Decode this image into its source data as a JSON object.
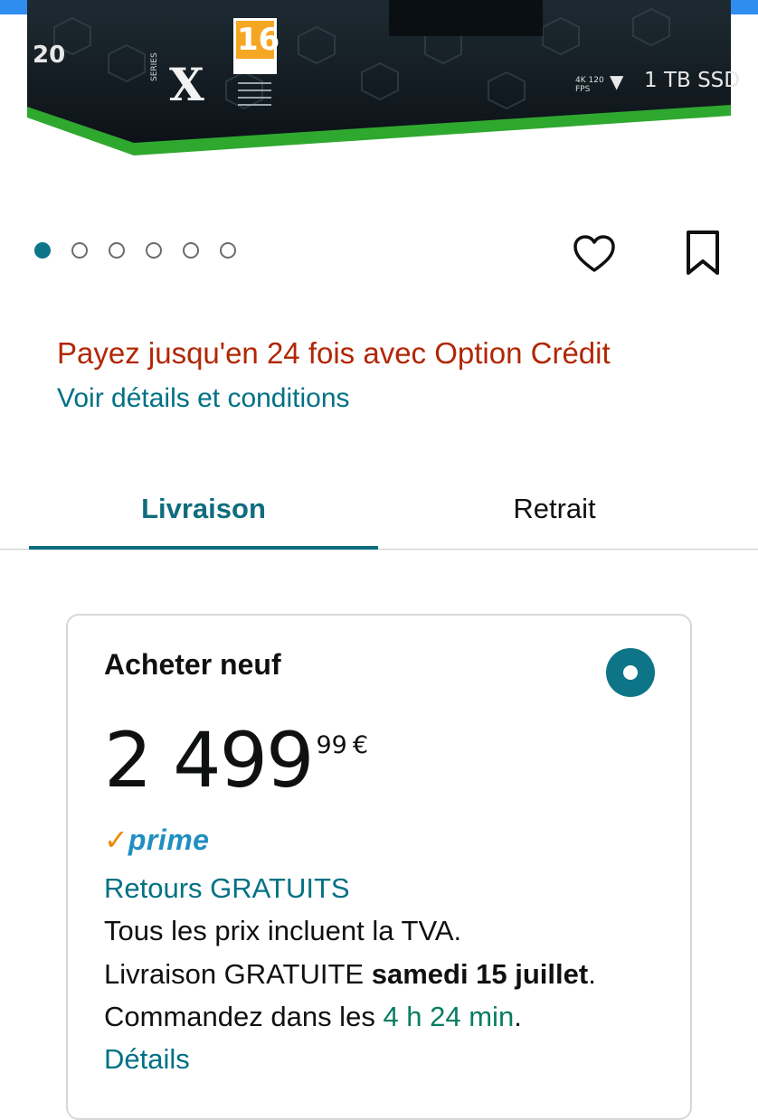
{
  "product_image": {
    "age_rating": "16",
    "series_badge": "X",
    "series_label": "SERIES",
    "spec_badge": "4K 120 FPS",
    "storage_badge": "1 TB SSD",
    "side_number": "20"
  },
  "carousel": {
    "count": 6,
    "active_index": 0
  },
  "actions": {
    "wishlist_icon": "heart-icon",
    "save_icon": "bookmark-icon"
  },
  "promo": {
    "text": "Payez jusqu'en 24 fois avec Option Crédit",
    "link": "Voir détails et conditions"
  },
  "tabs": {
    "delivery": "Livraison",
    "pickup": "Retrait",
    "selected": "Livraison"
  },
  "offer": {
    "title": "Acheter neuf",
    "selected": true,
    "price": {
      "whole": "2 499",
      "fraction": "99",
      "currency": "€"
    },
    "prime_label": "prime",
    "returns": "Retours GRATUITS",
    "vat_note": "Tous les prix incluent la TVA.",
    "delivery_prefix": "Livraison GRATUITE ",
    "delivery_date": "samedi 15 juillet",
    "delivery_suffix": ".",
    "order_prefix": "Commandez dans les ",
    "order_countdown": "4 h 24 min",
    "order_suffix": ".",
    "details_link": "Détails"
  },
  "colors": {
    "accent": "#0e7487",
    "promo": "#b12704",
    "link": "#007185",
    "green_text": "#067d62",
    "prime": "#1f8fc2",
    "prime_check": "#f08804",
    "xbox_green": "#2fa82f",
    "top_bar": "#2f8df0"
  }
}
